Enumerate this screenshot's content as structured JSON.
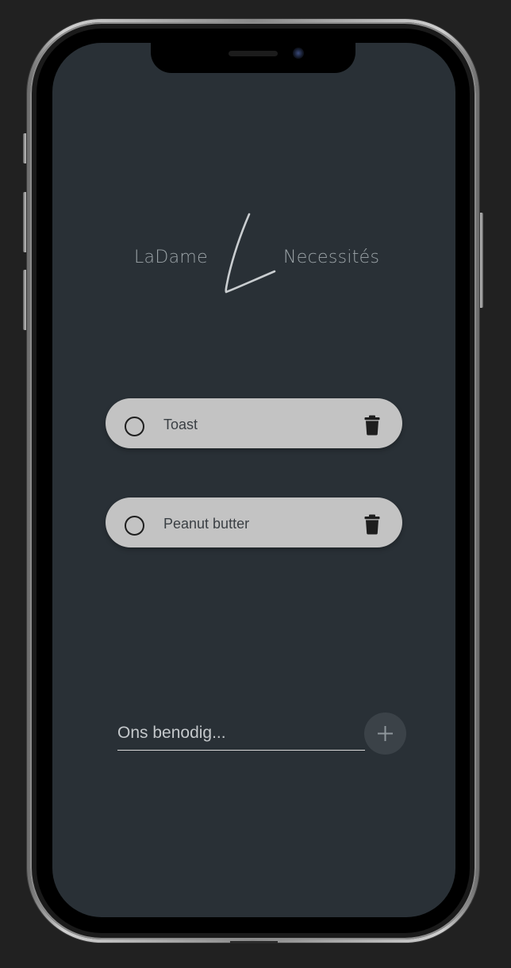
{
  "header": {
    "logo_left": "LaDame",
    "logo_right": "Necessités"
  },
  "todos": [
    {
      "label": "Toast",
      "completed": false
    },
    {
      "label": "Peanut butter",
      "completed": false
    }
  ],
  "new_item": {
    "placeholder": "Ons benodig...",
    "value": ""
  },
  "icons": {
    "check": "circle-outline-icon",
    "delete": "trash-icon",
    "add": "plus-icon",
    "logo": "signature-l-icon"
  },
  "colors": {
    "screen_background": "#293036",
    "item_background": "#c3c3c3",
    "add_button": "#3b4248",
    "logo_text": "#9ca4a8"
  }
}
